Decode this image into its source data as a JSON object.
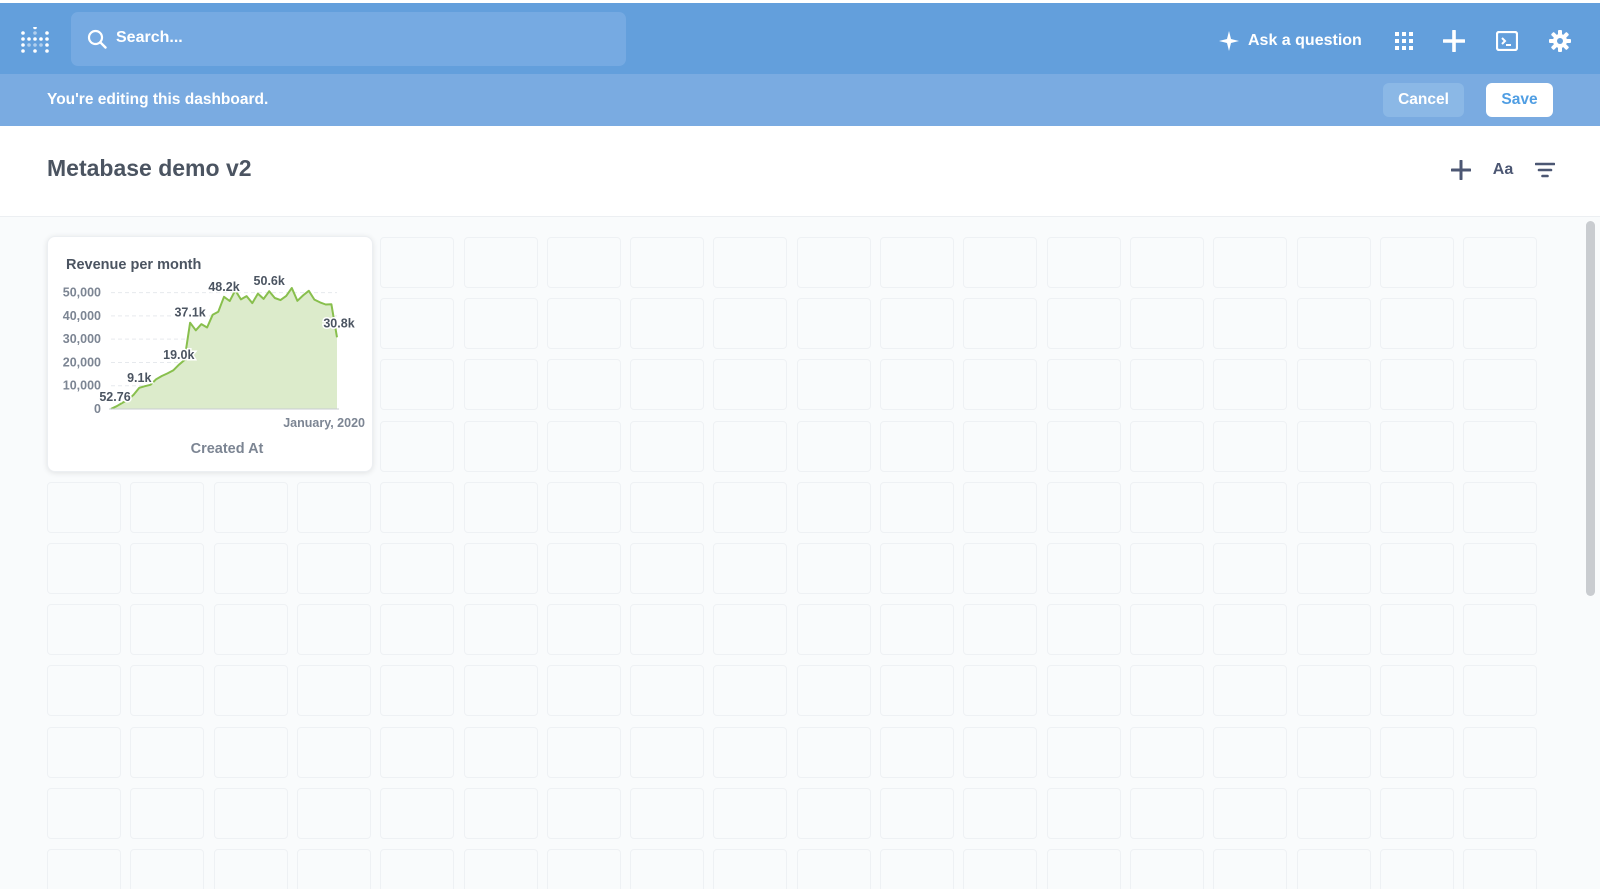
{
  "header": {
    "search_placeholder": "Search...",
    "ask_label": "Ask a question",
    "icons": [
      "metabase-logo-icon",
      "search-icon",
      "sparkle-icon",
      "grid-icon",
      "plus-icon",
      "terminal-icon",
      "gear-icon"
    ]
  },
  "edit_banner": {
    "message": "You're editing this dashboard.",
    "cancel_label": "Cancel",
    "save_label": "Save"
  },
  "dashboard": {
    "title": "Metabase demo v2",
    "text_button_label": "Aa",
    "icons": [
      "add-card-icon",
      "filter-icon"
    ]
  },
  "card": {
    "title": "Revenue per month",
    "xlabel": "Created At",
    "x_tick": "January, 2020",
    "y_ticks": [
      "50,000",
      "40,000",
      "30,000",
      "20,000",
      "10,000",
      "0"
    ]
  },
  "chart_data": {
    "type": "area",
    "title": "Revenue per month",
    "xlabel": "Created At",
    "ylabel": "",
    "ylim": [
      0,
      55000
    ],
    "color": "#88bf4d",
    "fill": "#dcebcb",
    "values": [
      52.76,
      1200,
      2600,
      4000,
      6100,
      9100,
      9800,
      10400,
      12800,
      14200,
      15300,
      16600,
      19000,
      21000,
      37100,
      33800,
      36500,
      35000,
      40500,
      41800,
      48200,
      46400,
      51000,
      47100,
      48500,
      45500,
      49600,
      47300,
      50600,
      47700,
      46800,
      48600,
      52000,
      46500,
      48800,
      50800,
      47000,
      45800,
      44900,
      45000,
      30800
    ],
    "data_labels": [
      {
        "index": 0,
        "label": "52.76"
      },
      {
        "index": 5,
        "label": "9.1k"
      },
      {
        "index": 12,
        "label": "19.0k"
      },
      {
        "index": 14,
        "label": "37.1k"
      },
      {
        "index": 20,
        "label": "48.2k"
      },
      {
        "index": 28,
        "label": "50.6k"
      },
      {
        "index": 40,
        "label": "30.8k"
      }
    ]
  }
}
